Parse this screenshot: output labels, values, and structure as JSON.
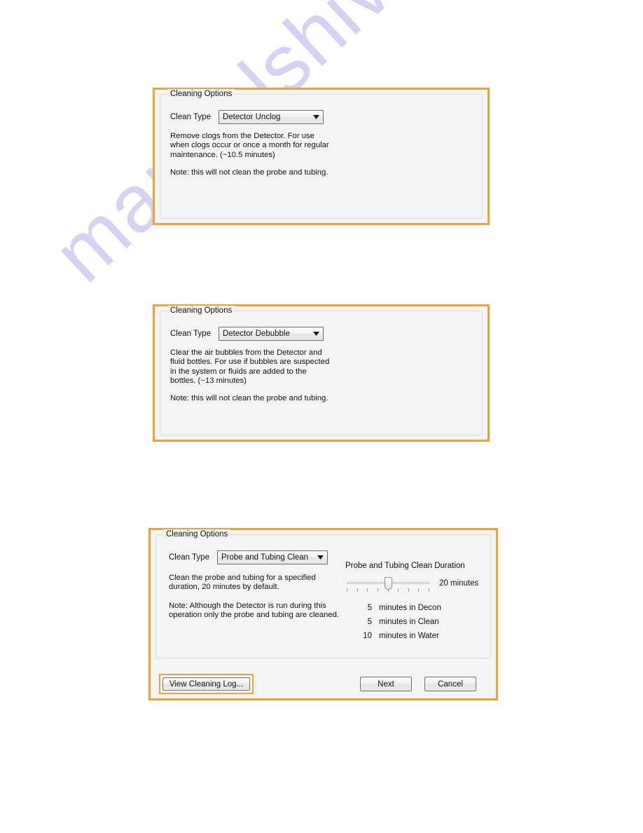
{
  "watermark": {
    "text": "manualshive.com",
    "color": "#d6d2f2"
  },
  "theme": {
    "highlight_border": "#eea236",
    "panel_background": "#f4f4f4",
    "groupbox_border": "#d9d9d9"
  },
  "panels": [
    {
      "legend": "Cleaning Options",
      "clean_type_label": "Clean Type",
      "clean_type_value": "Detector Unclog",
      "description": "Remove clogs from the Detector. For use when clogs occur or once a month for regular maintenance. (~10.5 minutes)",
      "note": "Note: this will not clean the probe and tubing."
    },
    {
      "legend": "Cleaning Options",
      "clean_type_label": "Clean Type",
      "clean_type_value": "Detector Debubble",
      "description": "Clear the air bubbles from the Detector and fluid bottles. For use if bubbles are suspected in the system or fluids are added to the bottles. (~13 minutes)",
      "note": "Note: this will not clean the probe and tubing."
    },
    {
      "legend": "Cleaning Options",
      "clean_type_label": "Clean Type",
      "clean_type_value": "Probe and Tubing Clean",
      "description": "Clean the probe and tubing for a specified duration, 20 minutes by default.",
      "note": "Note: Although the Detector is run during this operation only the probe and tubing are cleaned.",
      "duration": {
        "title": "Probe and Tubing Clean Duration",
        "value_label": "20 minutes",
        "slider": {
          "tick_count": 9,
          "thumb_index": 4,
          "min_minutes": 0,
          "max_minutes": 40,
          "current_minutes": 20
        },
        "breakdown": [
          {
            "minutes": "5",
            "text": "minutes in Decon"
          },
          {
            "minutes": "5",
            "text": "minutes in Clean"
          },
          {
            "minutes": "10",
            "text": "minutes in Water"
          }
        ]
      },
      "buttons": {
        "view_log": "View Cleaning Log...",
        "next": "Next",
        "cancel": "Cancel"
      }
    }
  ]
}
